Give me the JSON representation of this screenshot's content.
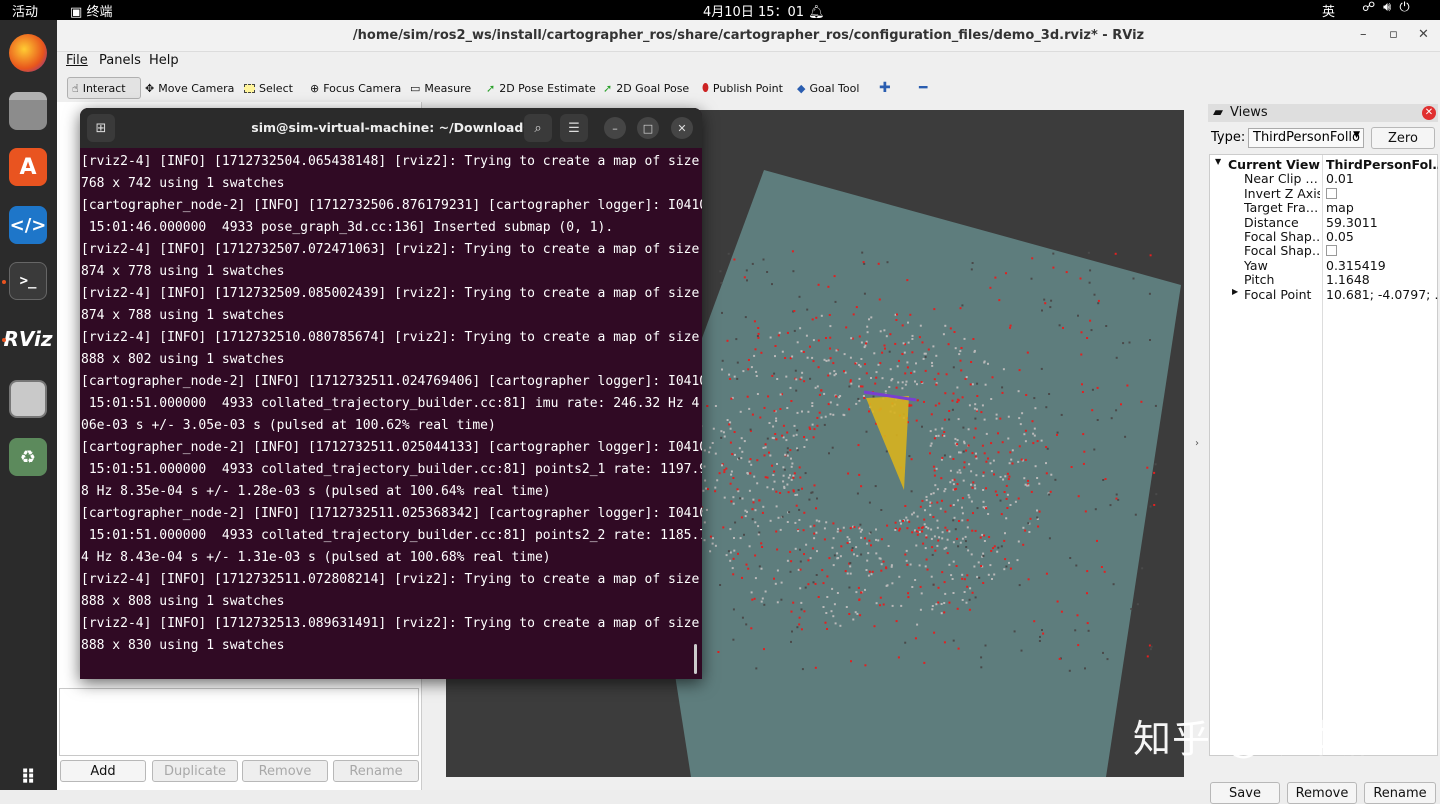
{
  "topbar": {
    "activities": "活动",
    "app_name": "终端",
    "clock": "4月10日  15：01",
    "ime": "英"
  },
  "window": {
    "title": "/home/sim/ros2_ws/install/cartographer_ros/share/cartographer_ros/configuration_files/demo_3d.rviz* - RViz",
    "min": "–",
    "max": "▫",
    "close": "✕"
  },
  "menu": {
    "file": "File",
    "panels": "Panels",
    "help": "Help"
  },
  "toolbar": {
    "interact": "Interact",
    "move_camera": "Move Camera",
    "select": "Select",
    "focus_camera": "Focus Camera",
    "measure": "Measure",
    "pose_estimate": "2D Pose Estimate",
    "goal_pose": "2D Goal Pose",
    "publish_point": "Publish Point",
    "goal_tool": "Goal Tool"
  },
  "left_buttons": {
    "add": "Add",
    "duplicate": "Duplicate",
    "remove": "Remove",
    "rename": "Rename"
  },
  "views": {
    "title": "Views",
    "type_label": "Type:",
    "type_value": "ThirdPersonFollo",
    "zero": "Zero",
    "props": [
      {
        "name": "Current View",
        "value": "ThirdPersonFol…"
      },
      {
        "name": "Near Clip …",
        "value": "0.01"
      },
      {
        "name": "Invert Z Axis",
        "value": ""
      },
      {
        "name": "Target Fra…",
        "value": "map"
      },
      {
        "name": "Distance",
        "value": "59.3011"
      },
      {
        "name": "Focal Shap…",
        "value": "0.05"
      },
      {
        "name": "Focal Shap…",
        "value": ""
      },
      {
        "name": "Yaw",
        "value": "0.315419"
      },
      {
        "name": "Pitch",
        "value": "1.1648"
      },
      {
        "name": "Focal Point",
        "value": "10.681; -4.0797; …"
      }
    ],
    "save": "Save",
    "remove": "Remove",
    "rename": "Rename"
  },
  "terminal": {
    "title": "sim@sim-virtual-machine: ~/Downloads",
    "lines": [
      "[rviz2-4] [INFO] [1712732504.065438148] [rviz2]: Trying to create a map of size",
      "768 x 742 using 1 swatches",
      "[cartographer_node-2] [INFO] [1712732506.876179231] [cartographer logger]: I0410",
      " 15:01:46.000000  4933 pose_graph_3d.cc:136] Inserted submap (0, 1).",
      "[rviz2-4] [INFO] [1712732507.072471063] [rviz2]: Trying to create a map of size",
      "874 x 778 using 1 swatches",
      "[rviz2-4] [INFO] [1712732509.085002439] [rviz2]: Trying to create a map of size",
      "874 x 788 using 1 swatches",
      "[rviz2-4] [INFO] [1712732510.080785674] [rviz2]: Trying to create a map of size",
      "888 x 802 using 1 swatches",
      "[cartographer_node-2] [INFO] [1712732511.024769406] [cartographer logger]: I0410",
      " 15:01:51.000000  4933 collated_trajectory_builder.cc:81] imu rate: 246.32 Hz 4.",
      "06e-03 s +/- 3.05e-03 s (pulsed at 100.62% real time)",
      "[cartographer_node-2] [INFO] [1712732511.025044133] [cartographer logger]: I0410",
      " 15:01:51.000000  4933 collated_trajectory_builder.cc:81] points2_1 rate: 1197.9",
      "8 Hz 8.35e-04 s +/- 1.28e-03 s (pulsed at 100.64% real time)",
      "[cartographer_node-2] [INFO] [1712732511.025368342] [cartographer logger]: I0410",
      " 15:01:51.000000  4933 collated_trajectory_builder.cc:81] points2_2 rate: 1185.7",
      "4 Hz 8.43e-04 s +/- 1.31e-03 s (pulsed at 100.68% real time)",
      "[rviz2-4] [INFO] [1712732511.072808214] [rviz2]: Trying to create a map of size",
      "888 x 808 using 1 swatches",
      "[rviz2-4] [INFO] [1712732513.089631491] [rviz2]: Trying to create a map of size",
      "888 x 830 using 1 swatches"
    ]
  },
  "watermark": "知乎 @张本庸",
  "colors": {
    "terminal_bg": "#300a24",
    "grid_plane": "#5e7d7d",
    "map_points": "#e32020",
    "path": "#d8b21e"
  }
}
